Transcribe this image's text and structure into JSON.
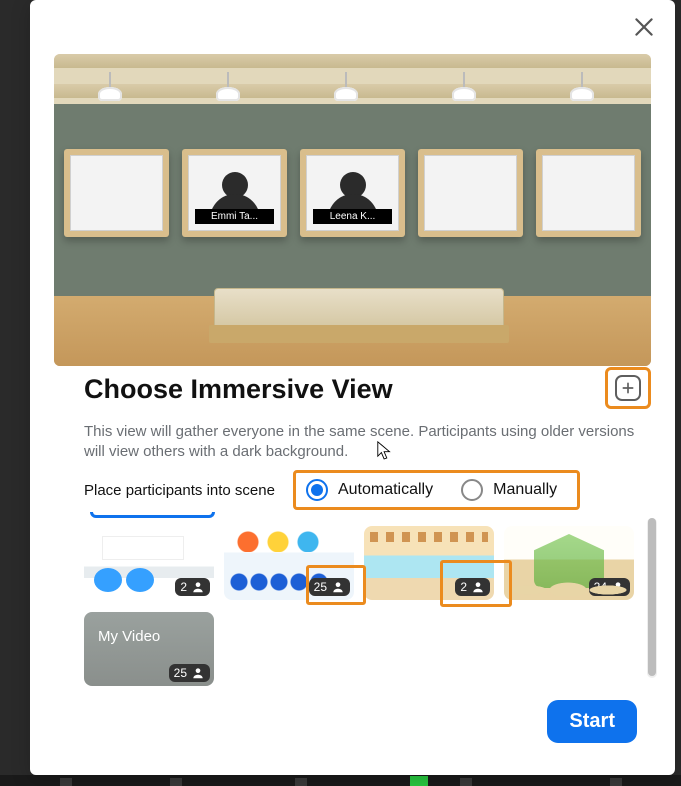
{
  "modal": {
    "title": "Choose Immersive View",
    "description": "This view will gather everyone in the same scene. Participants using older versions will view others with a dark background.",
    "placement_label": "Place participants into scene",
    "radio_auto": "Automatically",
    "radio_manual": "Manually",
    "selected_radio": "auto",
    "start_label": "Start"
  },
  "preview": {
    "participants": [
      {
        "name": "Emmi Ta..."
      },
      {
        "name": "Leena K..."
      }
    ]
  },
  "scenes": [
    {
      "id": "cafe",
      "capacity": "2"
    },
    {
      "id": "classroom",
      "capacity": "25"
    },
    {
      "id": "kitchen",
      "capacity": "2"
    },
    {
      "id": "treehouse",
      "capacity": "24"
    }
  ],
  "my_video": {
    "label": "My Video",
    "capacity": "25"
  },
  "colors": {
    "accent": "#0e72ed",
    "highlight": "#eb8b1e"
  }
}
